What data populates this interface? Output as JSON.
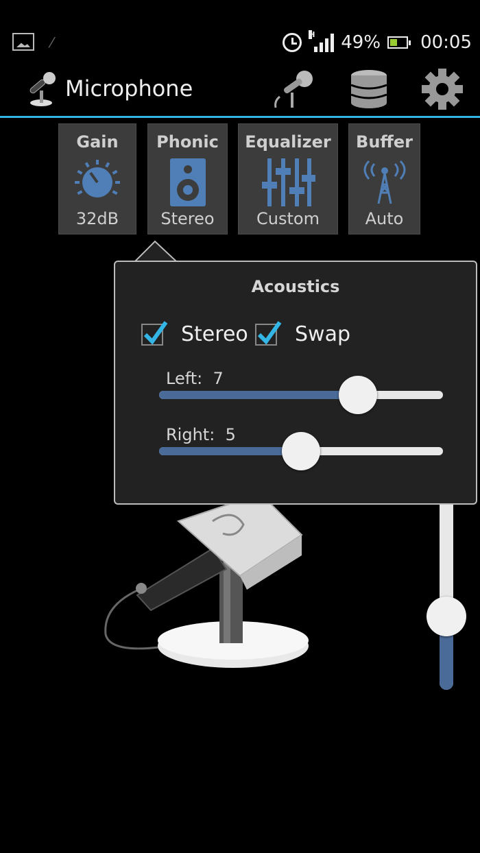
{
  "status_bar": {
    "battery": "49%",
    "time": "00:05",
    "network_type": "H",
    "icons": [
      "image-notification-icon",
      "usb-icon",
      "alarm-icon",
      "signal-icon",
      "battery-icon"
    ]
  },
  "action_bar": {
    "title": "Microphone",
    "accent_color": "#33b5e5",
    "actions": [
      "microphone-icon",
      "database-icon",
      "gear-icon"
    ]
  },
  "modes": [
    {
      "label": "Gain",
      "value": "32dB",
      "icon": "knob-icon"
    },
    {
      "label": "Phonic",
      "value": "Stereo",
      "icon": "speaker-icon"
    },
    {
      "label": "Equalizer",
      "value": "Custom",
      "icon": "equalizer-icon"
    },
    {
      "label": "Buffer",
      "value": "Auto",
      "icon": "broadcast-tower-icon"
    }
  ],
  "acoustics": {
    "title": "Acoustics",
    "stereo": {
      "label": "Stereo",
      "checked": true
    },
    "swap": {
      "label": "Swap",
      "checked": true
    },
    "left": {
      "label": "Left:",
      "value": "7",
      "fraction": 0.7
    },
    "right": {
      "label": "Right:",
      "value": "5",
      "fraction": 0.5
    }
  },
  "volume_slider": {
    "fraction": 0.35
  },
  "colors": {
    "slider_fill": "#4a6a98",
    "icon_blue": "#4f7fb6",
    "check_blue": "#33b5e5"
  }
}
